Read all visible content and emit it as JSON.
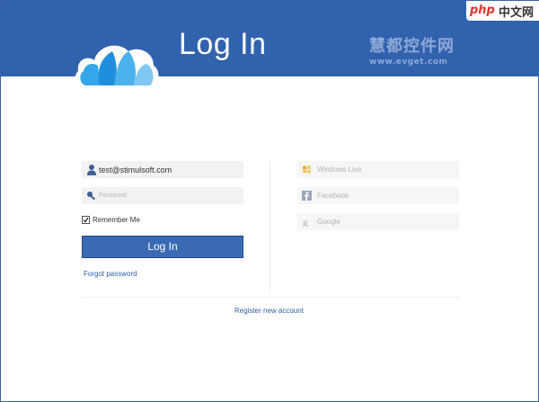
{
  "header": {
    "title": "Log In",
    "brand_color": "#3162ad"
  },
  "watermark": {
    "cn_text": "慧都控件网",
    "url_text": "www.evget.com"
  },
  "badge": {
    "php_text": "php",
    "cn_text": "中文网"
  },
  "login_form": {
    "username_value": "test@stimulsoft.com",
    "password_placeholder": "Password",
    "remember_label": "Remember Me",
    "remember_checked": true,
    "login_button_label": "Log In",
    "forgot_password_label": "Forgot password"
  },
  "social_logins": [
    {
      "label": "Windows Live",
      "icon": "windows-icon"
    },
    {
      "label": "Facebook",
      "icon": "facebook-icon"
    },
    {
      "label": "Google",
      "icon": "google-icon"
    }
  ],
  "register_label": "Register new account"
}
